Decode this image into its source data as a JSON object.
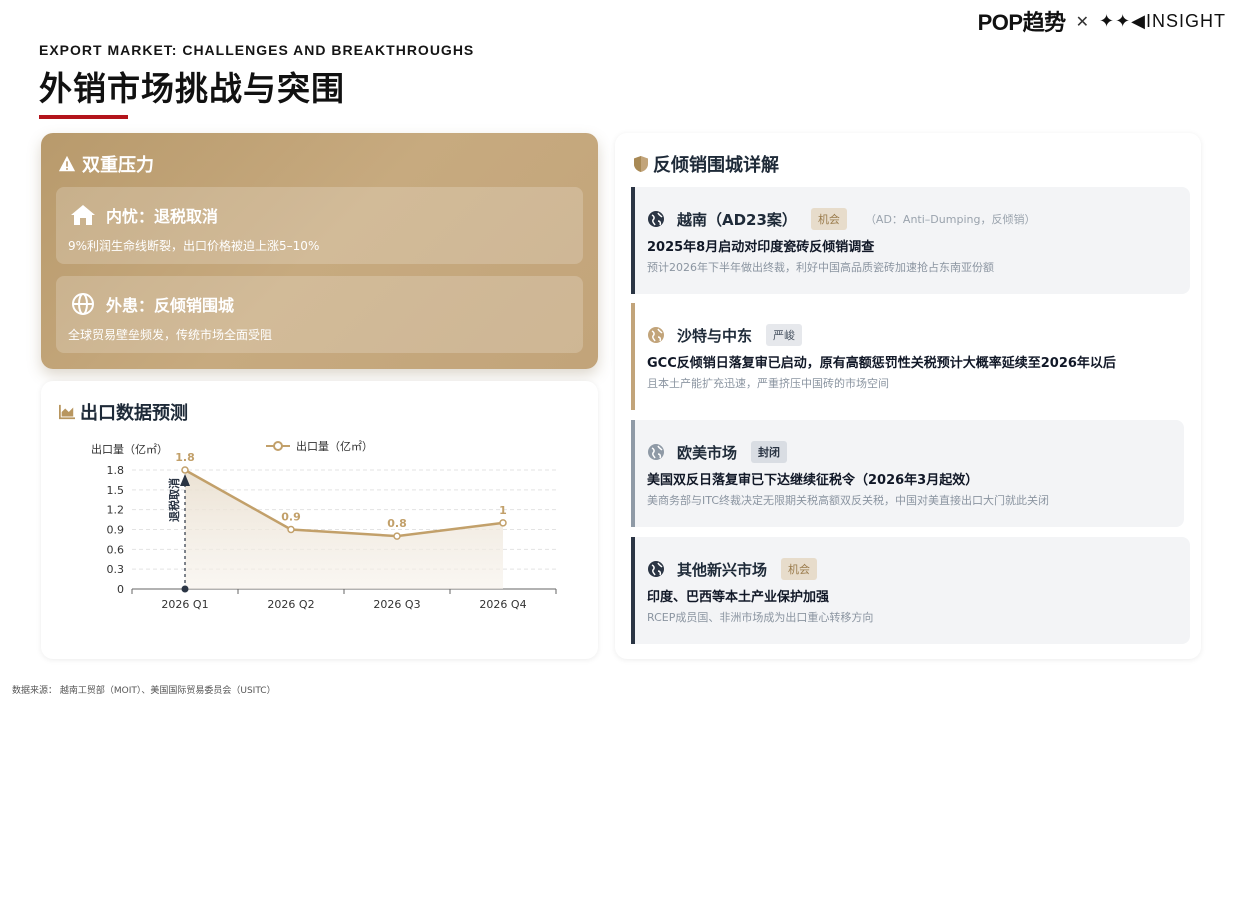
{
  "brand": {
    "pop": "POP趋势",
    "x": "✕",
    "insight": "✦✦◀INSIGHT"
  },
  "header": {
    "subtitle": "EXPORT MARKET: CHALLENGES AND BREAKTHROUGHS",
    "title": "外销市场挑战与突围"
  },
  "pressure": {
    "heading": "双重压力",
    "items": [
      {
        "title": "内忧：退税取消",
        "desc": "9%利润生命线断裂，出口价格被迫上涨5–10%"
      },
      {
        "title": "外患：反倾销围城",
        "desc": "全球贸易壁垒频发，传统市场全面受阻"
      }
    ]
  },
  "chart": {
    "heading": "出口数据预测",
    "legend": "出口量（亿㎡）",
    "annotation": "退税取消",
    "accent": "#c2a06a"
  },
  "chart_data": {
    "type": "line",
    "categories": [
      "2026 Q1",
      "2026 Q2",
      "2026 Q3",
      "2026 Q4"
    ],
    "series": [
      {
        "name": "出口量（亿㎡）",
        "values": [
          1.8,
          0.9,
          0.8,
          1
        ]
      }
    ],
    "ylabel": "出口量（亿㎡）",
    "yticks": [
      "0",
      "0.3",
      "0.6",
      "0.9",
      "1.2",
      "1.5",
      "1.8"
    ],
    "ylim": [
      0,
      1.8
    ],
    "grid": true,
    "legend_position": "top-center"
  },
  "antidumping": {
    "heading": "反倾销围城详解",
    "markets": [
      {
        "name": "越南（AD23案）",
        "tag": "机会",
        "note": "（AD：Anti–Dumping，反倾销）",
        "headline": "2025年8月启动对印度瓷砖反倾销调查",
        "desc": "预计2026年下半年做出终裁，利好中国高品质瓷砖加速抢占东南亚份额"
      },
      {
        "name": "沙特与中东",
        "tag": "严峻",
        "headline": "GCC反倾销日落复审已启动，原有高额惩罚性关税预计大概率延续至2026年以后",
        "desc": "且本土产能扩充迅速，严重挤压中国砖的市场空间"
      },
      {
        "name": "欧美市场",
        "tag": "封闭",
        "headline": "美国双反日落复审已下达继续征税令（2026年3月起效）",
        "desc": "美商务部与ITC终裁决定无限期关税高额双反关税，中国对美直接出口大门就此关闭"
      },
      {
        "name": "其他新兴市场",
        "tag": "机会",
        "headline": "印度、巴西等本土产业保护加强",
        "desc": "RCEP成员国、非洲市场成为出口重心转移方向"
      }
    ]
  },
  "source": "数据来源： 越南工贸部（MOIT）、美国国际贸易委员会（USITC）"
}
